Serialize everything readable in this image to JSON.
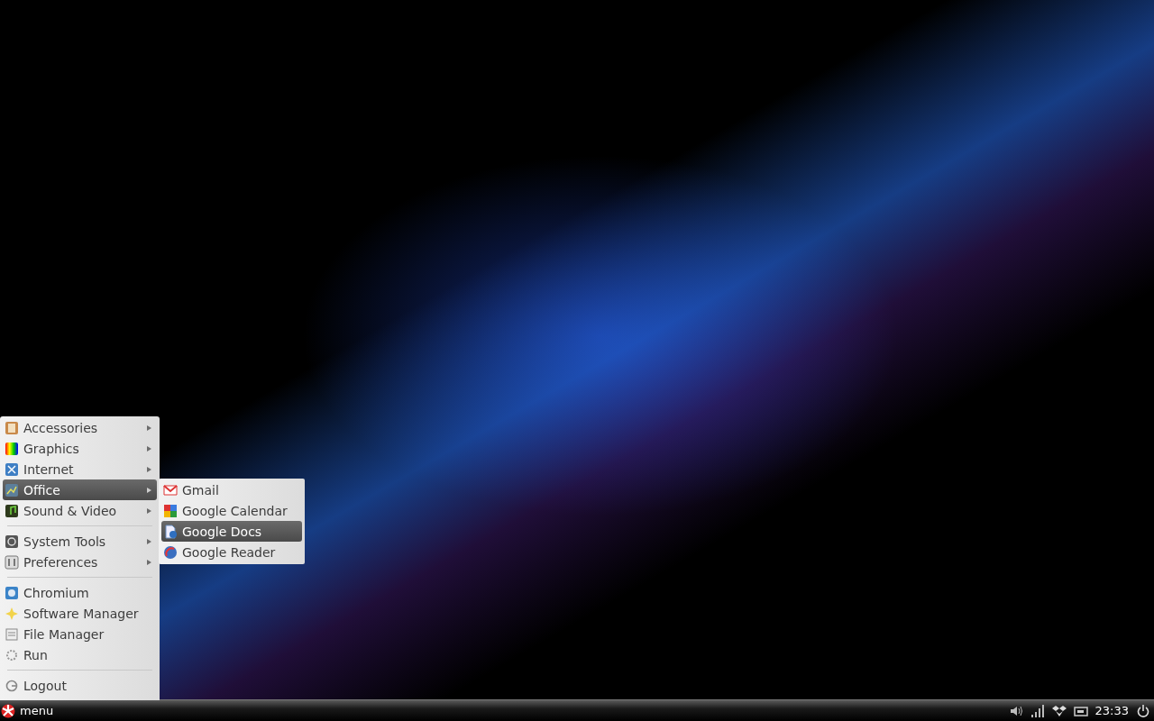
{
  "menu": {
    "groups": [
      [
        {
          "label": "Accessories",
          "submenu": true,
          "selected": false
        },
        {
          "label": "Graphics",
          "submenu": true,
          "selected": false
        },
        {
          "label": "Internet",
          "submenu": true,
          "selected": false
        },
        {
          "label": "Office",
          "submenu": true,
          "selected": true
        },
        {
          "label": "Sound & Video",
          "submenu": true,
          "selected": false
        }
      ],
      [
        {
          "label": "System Tools",
          "submenu": true,
          "selected": false
        },
        {
          "label": "Preferences",
          "submenu": true,
          "selected": false
        }
      ],
      [
        {
          "label": "Chromium",
          "submenu": false,
          "selected": false
        },
        {
          "label": "Software Manager",
          "submenu": false,
          "selected": false
        },
        {
          "label": "File Manager",
          "submenu": false,
          "selected": false
        },
        {
          "label": "Run",
          "submenu": false,
          "selected": false
        }
      ],
      [
        {
          "label": "Logout",
          "submenu": false,
          "selected": false
        }
      ]
    ]
  },
  "submenu": {
    "items": [
      {
        "label": "Gmail",
        "selected": false
      },
      {
        "label": "Google Calendar",
        "selected": false
      },
      {
        "label": "Google Docs",
        "selected": true
      },
      {
        "label": "Google Reader",
        "selected": false
      }
    ]
  },
  "taskbar": {
    "menu_label": "menu",
    "clock": "23:33"
  }
}
